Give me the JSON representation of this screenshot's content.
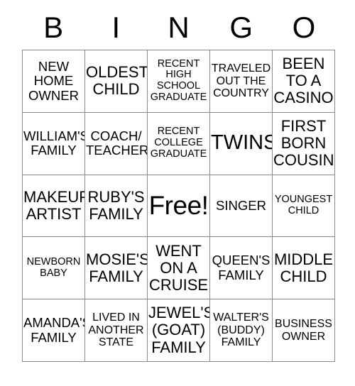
{
  "card": {
    "header_letters": [
      "B",
      "I",
      "N",
      "G",
      "O"
    ],
    "rows": [
      [
        {
          "text": "NEW\nHOME\nOWNER",
          "size": "m"
        },
        {
          "text": "OLDEST\nCHILD",
          "size": "l"
        },
        {
          "text": "RECENT\nHIGH\nSCHOOL\nGRADUATE",
          "size": "xs"
        },
        {
          "text": "TRAVELED\nOUT THE\nCOUNTRY",
          "size": "s"
        },
        {
          "text": "BEEN\nTO A\nCASINO",
          "size": "l"
        }
      ],
      [
        {
          "text": "WILLIAM'S\nFAMILY",
          "size": "m"
        },
        {
          "text": "COACH/\nTEACHER",
          "size": "m"
        },
        {
          "text": "RECENT\nCOLLEGE\nGRADUATE",
          "size": "xs"
        },
        {
          "text": "TWINS",
          "size": "xxl"
        },
        {
          "text": "FIRST\nBORN\nCOUSIN",
          "size": "l"
        }
      ],
      [
        {
          "text": "MAKEUP\nARTIST",
          "size": "l"
        },
        {
          "text": "RUBY'S\nFAMILY",
          "size": "l"
        },
        {
          "text": "Free!",
          "size": "free"
        },
        {
          "text": "SINGER",
          "size": "m"
        },
        {
          "text": "YOUNGEST\nCHILD",
          "size": "xs"
        }
      ],
      [
        {
          "text": "NEWBORN\nBABY",
          "size": "xs"
        },
        {
          "text": "MOSIE'S\nFAMILY",
          "size": "l"
        },
        {
          "text": "WENT\nON A\nCRUISE",
          "size": "l"
        },
        {
          "text": "QUEEN'S\nFAMILY",
          "size": "m"
        },
        {
          "text": "MIDDLE\nCHILD",
          "size": "l"
        }
      ],
      [
        {
          "text": "AMANDA'S\nFAMILY",
          "size": "m"
        },
        {
          "text": "LIVED IN\nANOTHER\nSTATE",
          "size": "s"
        },
        {
          "text": "JEWEL'S\n(GOAT)\nFAMILY",
          "size": "l"
        },
        {
          "text": "WALTER'S\n(BUDDY)\nFAMILY",
          "size": "s"
        },
        {
          "text": "BUSINESS\nOWNER",
          "size": "s"
        }
      ]
    ],
    "colors": {
      "background": "#ffffff",
      "text": "#000000",
      "grid_line": "#8a8a8a"
    }
  }
}
